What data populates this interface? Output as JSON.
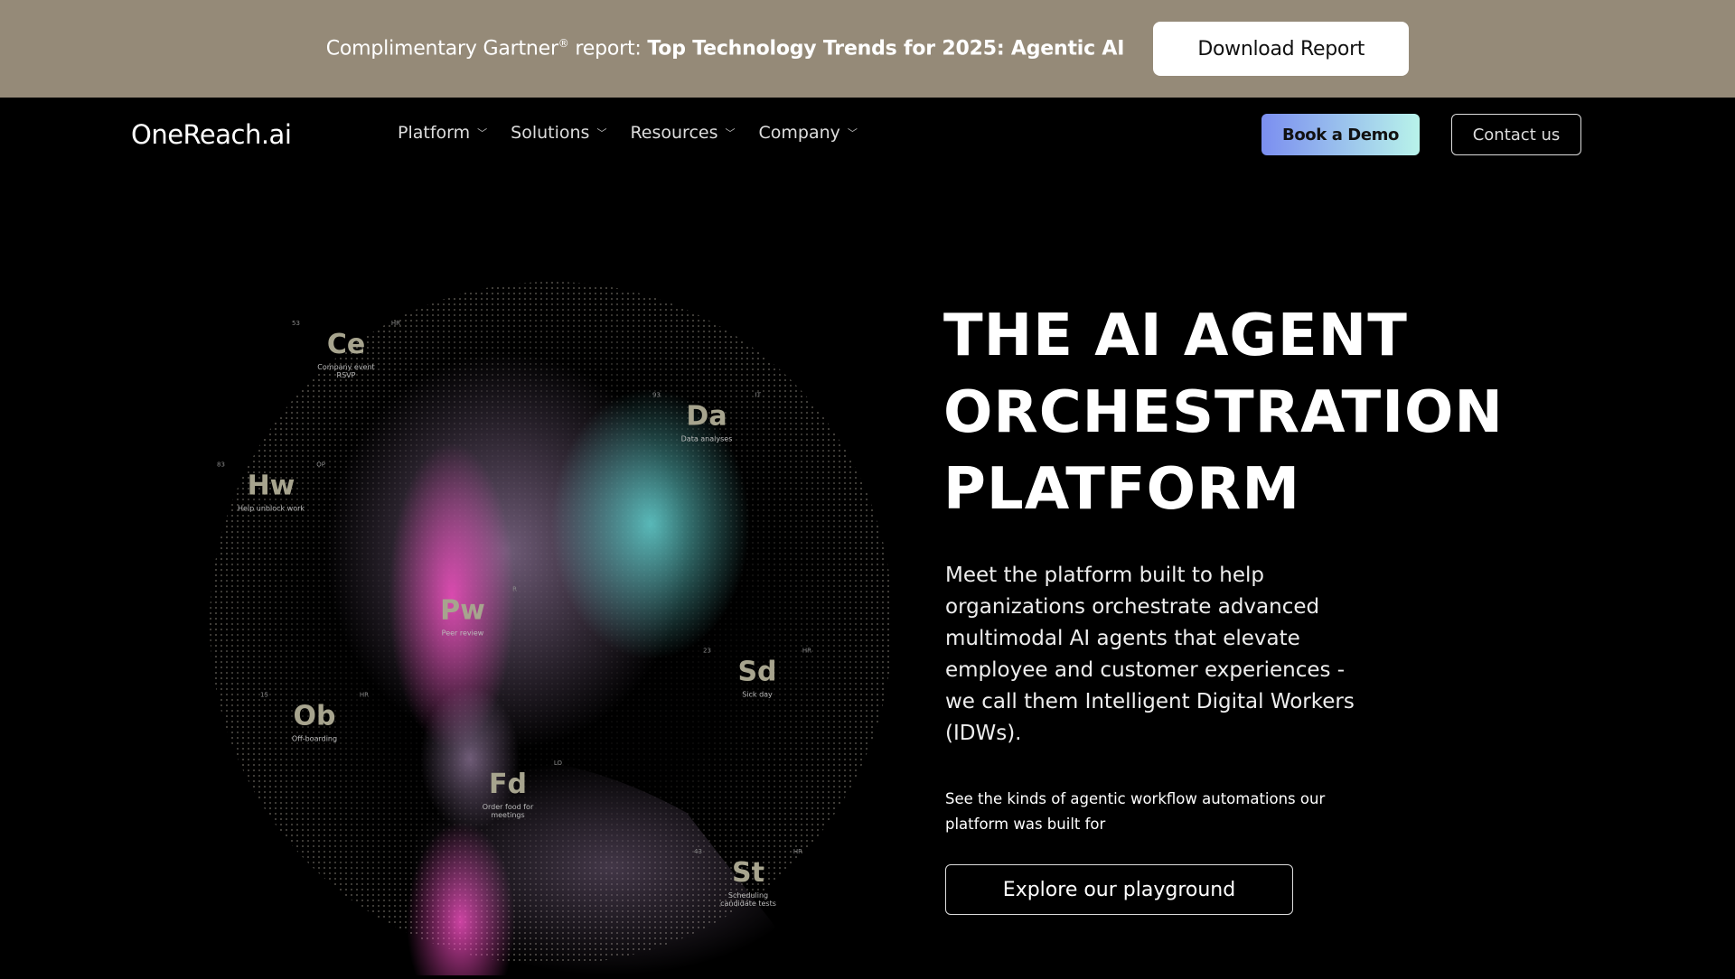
{
  "banner": {
    "prefix": "Complimentary Gartner",
    "registered": "®",
    "middle": " report: ",
    "bold": "Top Technology Trends for 2025: Agentic AI",
    "button": "Download Report",
    "background": "#958a78"
  },
  "nav": {
    "logo": "OneReach.ai",
    "items": [
      {
        "label": "Platform"
      },
      {
        "label": "Solutions"
      },
      {
        "label": "Resources"
      },
      {
        "label": "Company"
      }
    ],
    "demo": "Book a Demo",
    "contact": "Contact us"
  },
  "hero": {
    "title_lines": [
      "THE AI AGENT",
      "ORCHESTRATION",
      "PLATFORM"
    ],
    "lead": "Meet the platform built to help organizations orchestrate advanced multimodal AI agents that elevate employee and customer experiences - we call them Intelligent Digital Workers (IDWs).",
    "small": "See the kinds of agentic workflow automations our platform was built for",
    "cta": "Explore our playground"
  },
  "image_labels": [
    {
      "sym": "Ce",
      "desc": "Company event RSVP",
      "num": "53",
      "dept": "HR"
    },
    {
      "sym": "Da",
      "desc": "Data analyses",
      "num": "93",
      "dept": "IT"
    },
    {
      "sym": "Hw",
      "desc": "Help unblock work",
      "num": "83",
      "dept": "OP"
    },
    {
      "sym": "Pw",
      "desc": "Peer review",
      "num": "",
      "dept": "R"
    },
    {
      "sym": "Sd",
      "desc": "Sick day",
      "num": "23",
      "dept": "HR"
    },
    {
      "sym": "Ob",
      "desc": "Off-boarding",
      "num": "15",
      "dept": "HR"
    },
    {
      "sym": "Fd",
      "desc": "Order food for meetings",
      "num": "",
      "dept": "LO"
    },
    {
      "sym": "St",
      "desc": "Scheduling candidate tests",
      "num": "43",
      "dept": "HR"
    }
  ]
}
